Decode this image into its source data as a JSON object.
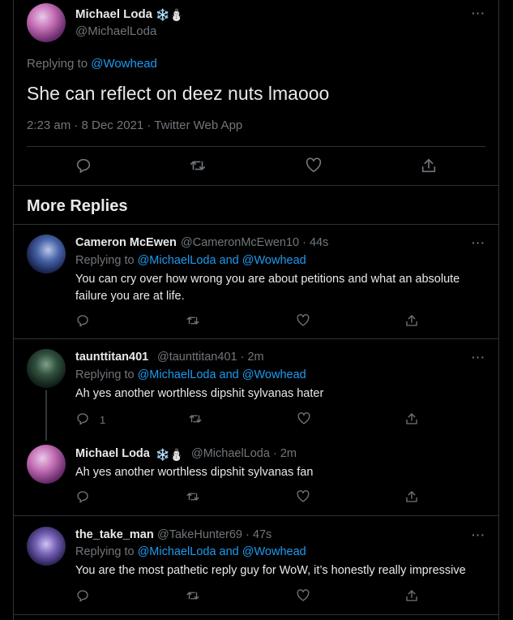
{
  "main_tweet": {
    "name": "Michael Loda",
    "emoji": "❄️⛄",
    "handle": "@MichaelLoda",
    "replying_prefix": "Replying to",
    "replying_to": "@Wowhead",
    "text": "She can reflect on deez nuts lmaooo",
    "meta": "2:23 am · 8 Dec 2021 · Twitter Web App"
  },
  "section_title": "More Replies",
  "replies": [
    {
      "name": "Cameron McEwen",
      "handle_time": "@CameronMcEwen10 · 44s",
      "replying_prefix": "Replying to",
      "replying_to": "@MichaelLoda and @Wowhead",
      "text_line1": "You can cry over how wrong you are about petitions and what an absolute",
      "text_line2": "failure you are at life.",
      "reply_count": ""
    },
    {
      "name": "taunttitan401",
      "handle_time": "@taunttitan401 · 2m",
      "replying_prefix": "Replying to",
      "replying_to": "@MichaelLoda and @Wowhead",
      "text": "Ah yes another worthless dipshit sylvanas hater",
      "reply_count": "1"
    },
    {
      "name": "Michael Loda",
      "emoji": "❄️⛄",
      "handle_time": "@MichaelLoda · 2m",
      "text": "Ah yes another worthless dipshit sylvanas fan",
      "reply_count": ""
    },
    {
      "name": "the_take_man",
      "handle_time": "@TakeHunter69 · 47s",
      "replying_prefix": "Replying to",
      "replying_to": "@MichaelLoda and @Wowhead",
      "text": "You are the most pathetic reply guy for WoW, it’s honestly really impressive",
      "reply_count": ""
    }
  ],
  "more_icon": "···",
  "icons": [
    "reply-icon",
    "retweet-icon",
    "like-icon",
    "share-icon",
    "more-options-icon"
  ]
}
